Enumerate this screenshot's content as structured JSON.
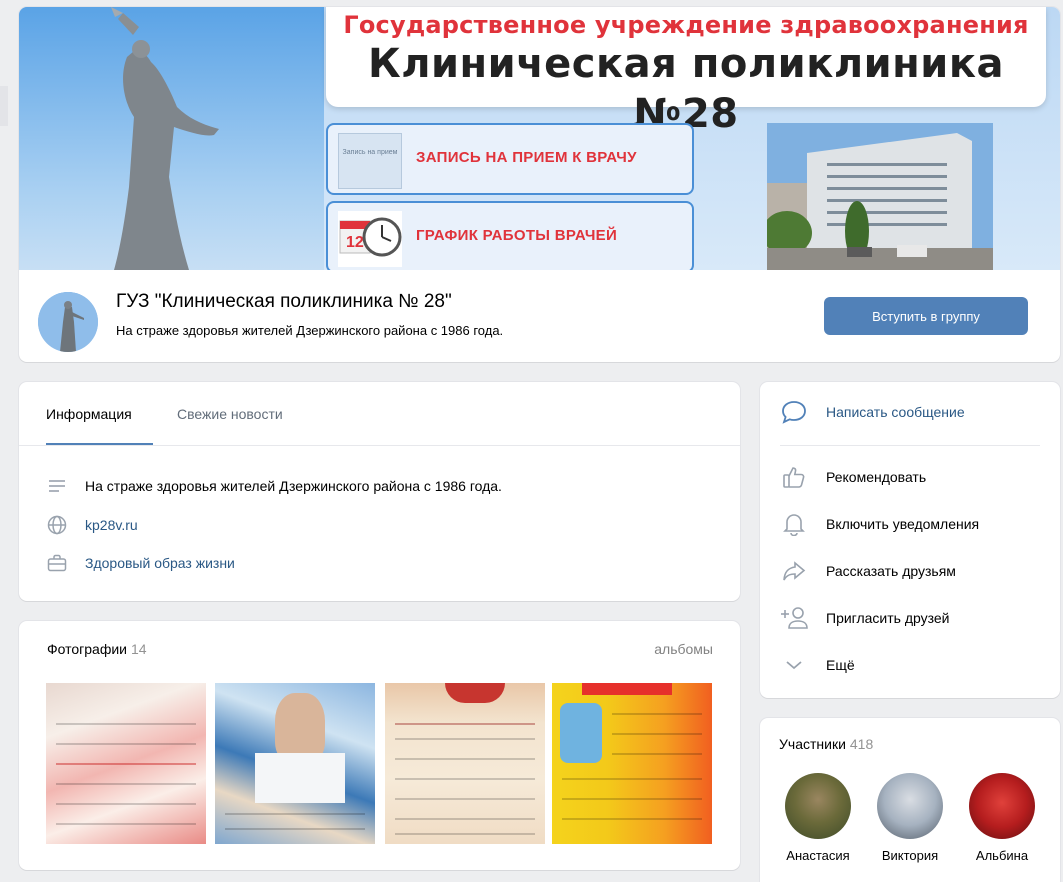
{
  "cover": {
    "title_top": "Государственное учреждение здравоохранения",
    "title_main": "Клиническая поликлиника №28",
    "button_1_thumb_text": "Запись на прием",
    "button_1_label": "ЗАПИСЬ НА ПРИЕМ К ВРАЧУ",
    "button_2_label": "ГРАФИК РАБОТЫ ВРАЧЕЙ"
  },
  "group": {
    "name": "ГУЗ \"Клиническая поликлиника № 28\"",
    "status": "На страже здоровья жителей Дзержинского района с 1986 года.",
    "join_label": "Вступить в группу"
  },
  "info": {
    "tabs": [
      {
        "label": "Информация",
        "active": true
      },
      {
        "label": "Свежие новости",
        "active": false
      }
    ],
    "rows": [
      {
        "icon": "lines-icon",
        "text": "На страже здоровья жителей Дзержинского района с 1986 года."
      },
      {
        "icon": "globe-icon",
        "text": "kp28v.ru"
      },
      {
        "icon": "briefcase-icon",
        "text": "Здоровый образ жизни"
      }
    ]
  },
  "photos": {
    "title": "Фотографии",
    "count": "14",
    "albums_label": "альбомы"
  },
  "actions": {
    "message": "Написать сообщение",
    "recommend": "Рекомендовать",
    "notify": "Включить уведомления",
    "share": "Рассказать друзьям",
    "invite": "Пригласить друзей",
    "more": "Ещё"
  },
  "members": {
    "title": "Участники",
    "count": "418",
    "list": [
      {
        "name": "Анастасия"
      },
      {
        "name": "Виктория"
      },
      {
        "name": "Альбина"
      }
    ]
  },
  "colors": {
    "accent": "#5181b8",
    "link": "#2a5885",
    "cover_red": "#e0333b"
  }
}
